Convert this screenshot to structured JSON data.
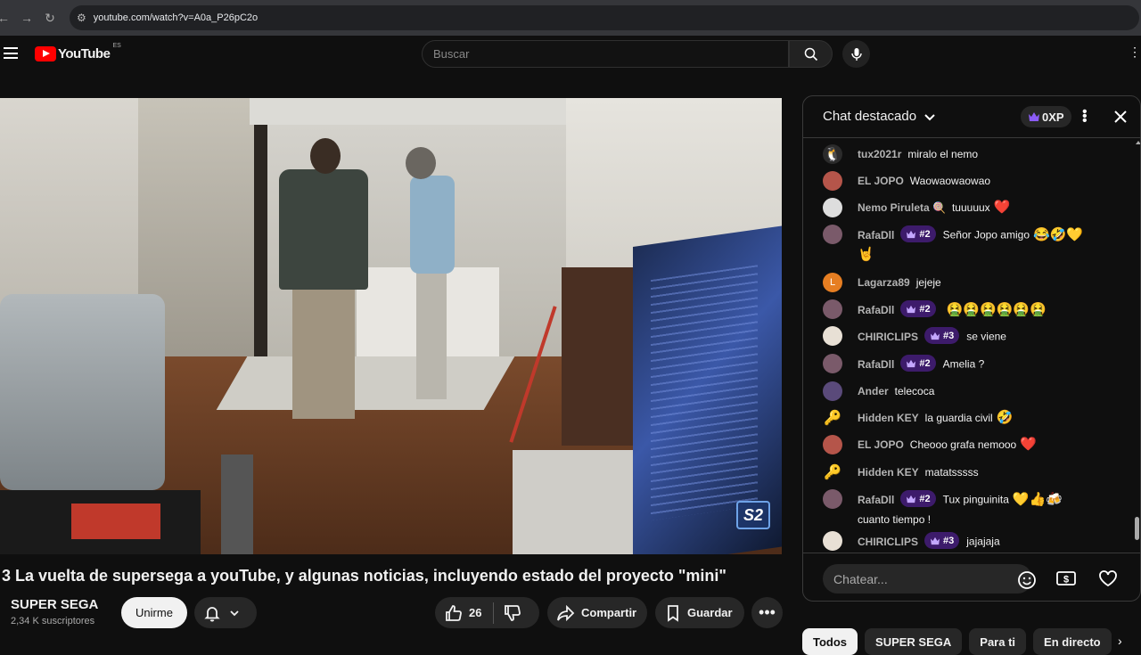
{
  "browser": {
    "url": "youtube.com/watch?v=A0a_P26pC2o"
  },
  "header": {
    "logo_text": "YouTube",
    "country_code": "ES",
    "search_placeholder": "Buscar"
  },
  "video": {
    "watermark": "S2",
    "title": "3 La vuelta de supersega a youTube, y algunas noticias, incluyendo estado del proyecto \"mini\"",
    "channel": "SUPER SEGA",
    "subscribers": "2,34 K suscriptores",
    "join_label": "Unirme",
    "likes": "26",
    "share_label": "Compartir",
    "save_label": "Guardar"
  },
  "chat": {
    "title": "Chat destacado",
    "xp": "0XP",
    "input_placeholder": "Chatear...",
    "messages": [
      {
        "author": "tux2021r",
        "badge": "",
        "text": "miralo el nemo",
        "emoji": "",
        "avatar_color": "#2b2b2b",
        "avatar_icon": "penguin-avatar"
      },
      {
        "author": "EL JOPO",
        "badge": "",
        "text": "Waowaowaowao",
        "emoji": "",
        "avatar_color": "#b5554a",
        "avatar_icon": "user-avatar"
      },
      {
        "author": "Nemo Piruleta 🍭",
        "badge": "",
        "text": "tuuuuux",
        "emoji": "❤️",
        "avatar_color": "#ddd",
        "avatar_icon": "user-avatar"
      },
      {
        "author": "RafaDll",
        "badge": "#2",
        "text": "Señor Jopo amigo",
        "emoji": "😂🤣💛",
        "text2": "🤘",
        "avatar_color": "#7a5a6a",
        "avatar_icon": "user-avatar"
      },
      {
        "author": "Lagarza89",
        "badge": "",
        "text": "jejeje",
        "emoji": "",
        "avatar_color": "#e67e22",
        "avatar_letter": "L",
        "avatar_icon": "letter-avatar"
      },
      {
        "author": "RafaDll",
        "badge": "#2",
        "text": "",
        "emoji": "🤮🤮🤮🤮🤮🤮",
        "avatar_color": "#7a5a6a",
        "avatar_icon": "user-avatar"
      },
      {
        "author": "CHIRICLIPS",
        "badge": "#3",
        "text": "se viene",
        "emoji": "",
        "avatar_color": "#e8e0d5",
        "avatar_icon": "user-avatar"
      },
      {
        "author": "RafaDll",
        "badge": "#2",
        "text": "Amelia ?",
        "emoji": "",
        "avatar_color": "#7a5a6a",
        "avatar_icon": "user-avatar"
      },
      {
        "author": "Ander",
        "badge": "",
        "text": "telecoca",
        "emoji": "",
        "avatar_color": "#5a4a7a",
        "avatar_icon": "user-avatar"
      },
      {
        "author": "Hidden KEY",
        "badge": "",
        "text": "la guardia civil",
        "emoji": "🤣",
        "avatar_color": "transparent",
        "avatar_icon": "key-avatar"
      },
      {
        "author": "EL JOPO",
        "badge": "",
        "text": "Cheooo grafa nemooo",
        "emoji": "❤️",
        "avatar_color": "#b5554a",
        "avatar_icon": "user-avatar"
      },
      {
        "author": "Hidden KEY",
        "badge": "",
        "text": "matatsssss",
        "emoji": "",
        "avatar_color": "transparent",
        "avatar_icon": "key-avatar"
      },
      {
        "author": "RafaDll",
        "badge": "#2",
        "text": "Tux pinguinita",
        "emoji": "💛👍🍻",
        "text2": "cuanto tiempo !",
        "avatar_color": "#7a5a6a",
        "avatar_icon": "user-avatar"
      },
      {
        "author": "CHIRICLIPS",
        "badge": "#3",
        "text": "jajajaja",
        "emoji": "",
        "avatar_color": "#e8e0d5",
        "avatar_icon": "user-avatar"
      }
    ]
  },
  "chips": [
    "Todos",
    "SUPER SEGA",
    "Para ti",
    "En directo"
  ]
}
